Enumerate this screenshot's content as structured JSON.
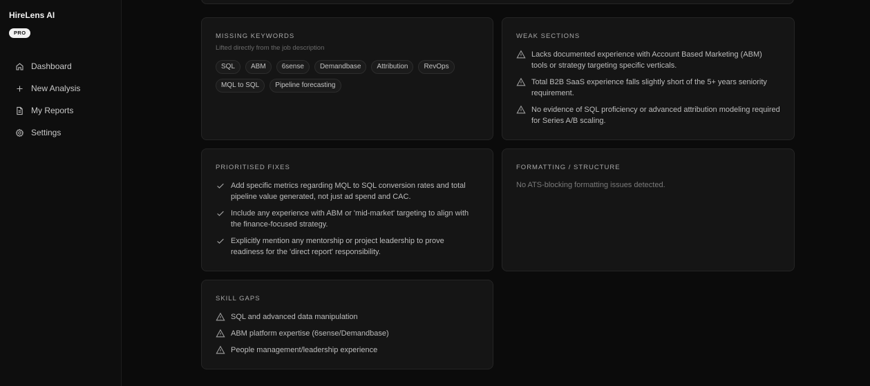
{
  "app": {
    "name": "HireLens AI",
    "plan_badge": "PRO"
  },
  "sidebar": {
    "items": [
      {
        "label": "Dashboard",
        "icon": "home-icon"
      },
      {
        "label": "New Analysis",
        "icon": "plus-icon"
      },
      {
        "label": "My Reports",
        "icon": "document-icon"
      },
      {
        "label": "Settings",
        "icon": "gear-icon"
      }
    ]
  },
  "missing_keywords": {
    "title": "MISSING KEYWORDS",
    "subtitle": "Lifted directly from the job description",
    "tags": [
      "SQL",
      "ABM",
      "6sense",
      "Demandbase",
      "Attribution",
      "RevOps",
      "MQL to SQL",
      "Pipeline forecasting"
    ]
  },
  "weak_sections": {
    "title": "WEAK SECTIONS",
    "items": [
      "Lacks documented experience with Account Based Marketing (ABM) tools or strategy targeting specific verticals.",
      "Total B2B SaaS experience falls slightly short of the 5+ years seniority requirement.",
      "No evidence of SQL proficiency or advanced attribution modeling required for Series A/B scaling."
    ]
  },
  "prioritised_fixes": {
    "title": "PRIORITISED FIXES",
    "items": [
      "Add specific metrics regarding MQL to SQL conversion rates and total pipeline value generated, not just ad spend and CAC.",
      "Include any experience with ABM or 'mid-market' targeting to align with the finance-focused strategy.",
      "Explicitly mention any mentorship or project leadership to prove readiness for the 'direct report' responsibility."
    ]
  },
  "formatting": {
    "title": "FORMATTING / STRUCTURE",
    "message": "No ATS-blocking formatting issues detected."
  },
  "skill_gaps": {
    "title": "SKILL GAPS",
    "items": [
      "SQL and advanced data manipulation",
      "ABM platform expertise (6sense/Demandbase)",
      "People management/leadership experience"
    ]
  }
}
